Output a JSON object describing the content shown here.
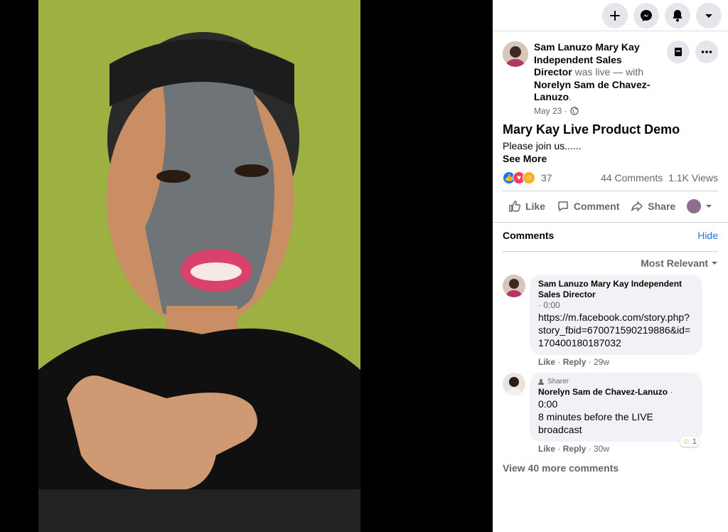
{
  "topbar": {
    "icons": [
      "plus-icon",
      "messenger-icon",
      "notifications-icon",
      "account-menu-icon"
    ]
  },
  "post": {
    "author": "Sam Lanuzo Mary Kay Independent Sales Director",
    "was_live": "was live — with",
    "with_user": "Norelyn Sam de Chavez-Lanuzo",
    "with_suffix": ".",
    "date": "May 23 ·",
    "title": "Mary Kay Live Product Demo",
    "description": "Please join us......",
    "see_more": "See More",
    "reaction_count": "37",
    "comments_count": "44 Comments",
    "views_count": "1.1K Views",
    "reaction_colors": {
      "like": "#1877f2",
      "love": "#f33e58",
      "care": "#f7b125"
    }
  },
  "actions": {
    "like": "Like",
    "comment": "Comment",
    "share": "Share"
  },
  "comments_section": {
    "title": "Comments",
    "hide": "Hide",
    "sort": "Most Relevant",
    "items": [
      {
        "name": "Sam Lanuzo Mary Kay Independent Sales Director",
        "time": "· 0:00",
        "text": "https://m.facebook.com/story.php?story_fbid=670071590219886&id=170400180187032",
        "like": "Like",
        "reply": "Reply",
        "age": "· 29w"
      },
      {
        "badge": "Sharer",
        "name": "Norelyn Sam de Chavez-Lanuzo",
        "time": "0:00",
        "text": "8 minutes before the LIVE broadcast",
        "like": "Like",
        "reply": "Reply",
        "age": "· 30w",
        "reaction_count": "1"
      }
    ],
    "view_more": "View 40 more comments"
  }
}
